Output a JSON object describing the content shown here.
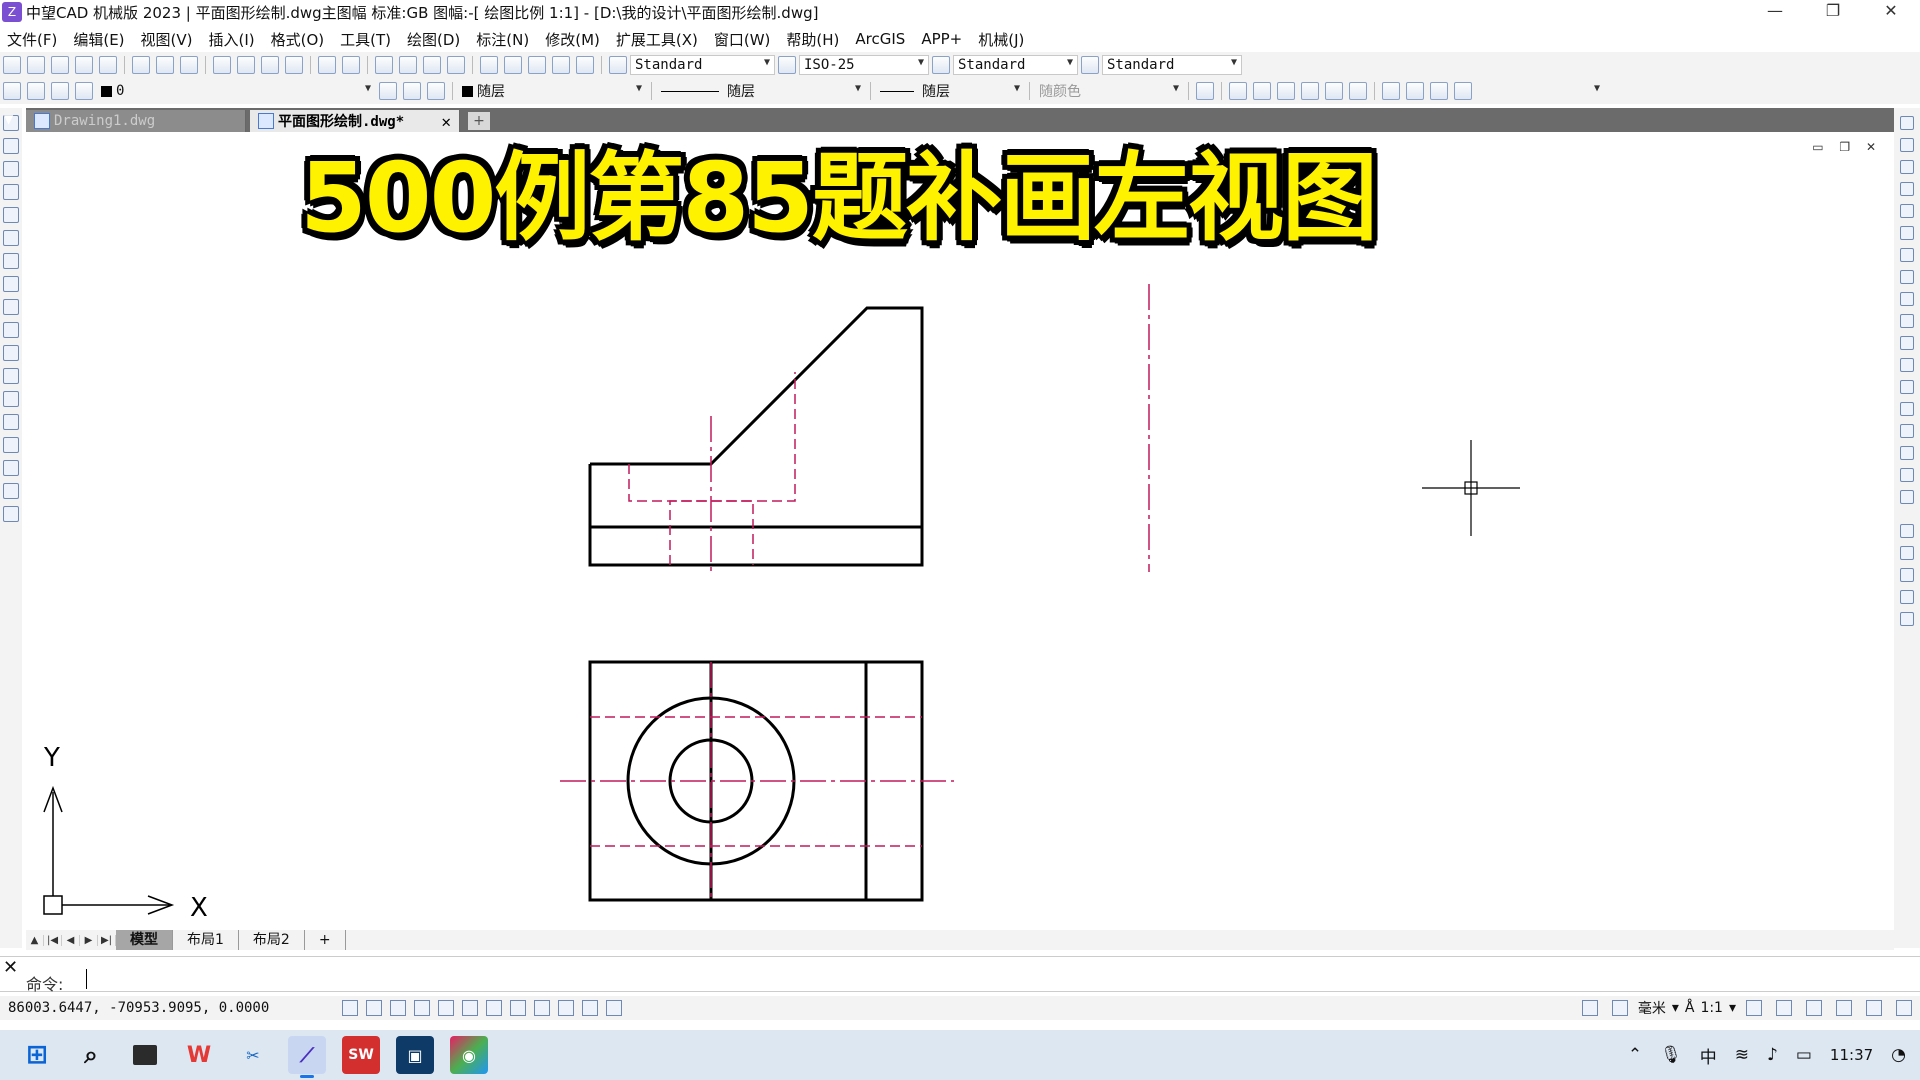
{
  "window": {
    "title": "中望CAD 机械版 2023 | 平面图形绘制.dwg主图幅  标准:GB 图幅:-[ 绘图比例 1:1] - [D:\\我的设计\\平面图形绘制.dwg]",
    "minimize": "—",
    "restore": "❐",
    "close": "✕"
  },
  "menu": [
    "文件(F)",
    "编辑(E)",
    "视图(V)",
    "插入(I)",
    "格式(O)",
    "工具(T)",
    "绘图(D)",
    "标注(N)",
    "修改(M)",
    "扩展工具(X)",
    "窗口(W)",
    "帮助(H)",
    "ArcGIS",
    "APP+",
    "机械(J)"
  ],
  "toolbar": {
    "text_style": "Standard",
    "dim_style": "ISO-25",
    "table_style": "Standard",
    "mleader_style": "Standard",
    "layer": "0",
    "color": "随层",
    "linetype": "随层",
    "lineweight": "随层",
    "plotstyle": "随颜色"
  },
  "tabs": [
    {
      "label": "Drawing1.dwg"
    },
    {
      "label": "平面图形绘制.dwg*"
    }
  ],
  "tab_close": "✕",
  "tab_add": "+",
  "overlay": {
    "title": "500例第85题补画左视图"
  },
  "canvas_controls": "▭ ❐ ✕",
  "ucs": {
    "x_label": "X",
    "y_label": "Y"
  },
  "layouts": [
    "模型",
    "布局1",
    "布局2",
    "+"
  ],
  "command": {
    "prompt": "命令:",
    "close": "✕"
  },
  "status": {
    "coordinates": "86003.6447,  -70953.9095,  0.0000",
    "unit": "毫米",
    "scale": "1:1"
  },
  "taskbar": {
    "apps": [
      "windows-start",
      "search",
      "file-explorer",
      "wps",
      "snipping-tool",
      "zwcad",
      "solidworks",
      "app-blue",
      "app-color"
    ],
    "ime": "中",
    "time": "11:37"
  },
  "colors": {
    "overlay_text": "#fff200",
    "hidden_line": "#c2185b",
    "center_line": "#c2185b",
    "object_line": "#000000"
  }
}
